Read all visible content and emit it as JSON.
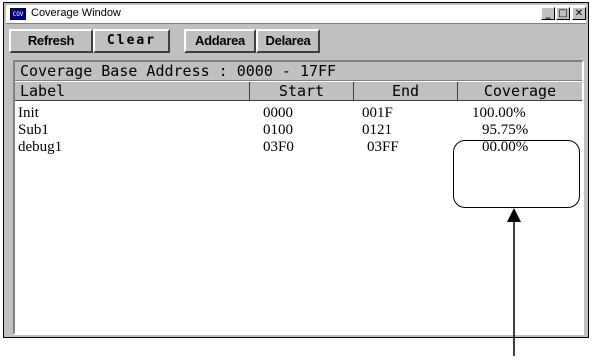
{
  "window": {
    "title": "Coverage Window",
    "icon_text": "COV",
    "controls": {
      "minimize": "_",
      "maximize": "□",
      "close": "✕"
    }
  },
  "toolbar": {
    "refresh_label": "Refresh",
    "clear_label": "Clear",
    "addarea_label": "Addarea",
    "delarea_label": "Delarea"
  },
  "info": {
    "base_address": "Coverage Base Address : 0000 - 17FF"
  },
  "table": {
    "columns": [
      "Label",
      "Start",
      "End",
      "Coverage"
    ],
    "rows": [
      {
        "label": "Init",
        "start": "0000",
        "end": "001F",
        "coverage": "100.00%"
      },
      {
        "label": "Sub1",
        "start": "0100",
        "end": "0121",
        "coverage": "95.75%"
      },
      {
        "label": "debug1",
        "start": "03F0",
        "end": "03FF",
        "coverage": "00.00%"
      }
    ]
  }
}
